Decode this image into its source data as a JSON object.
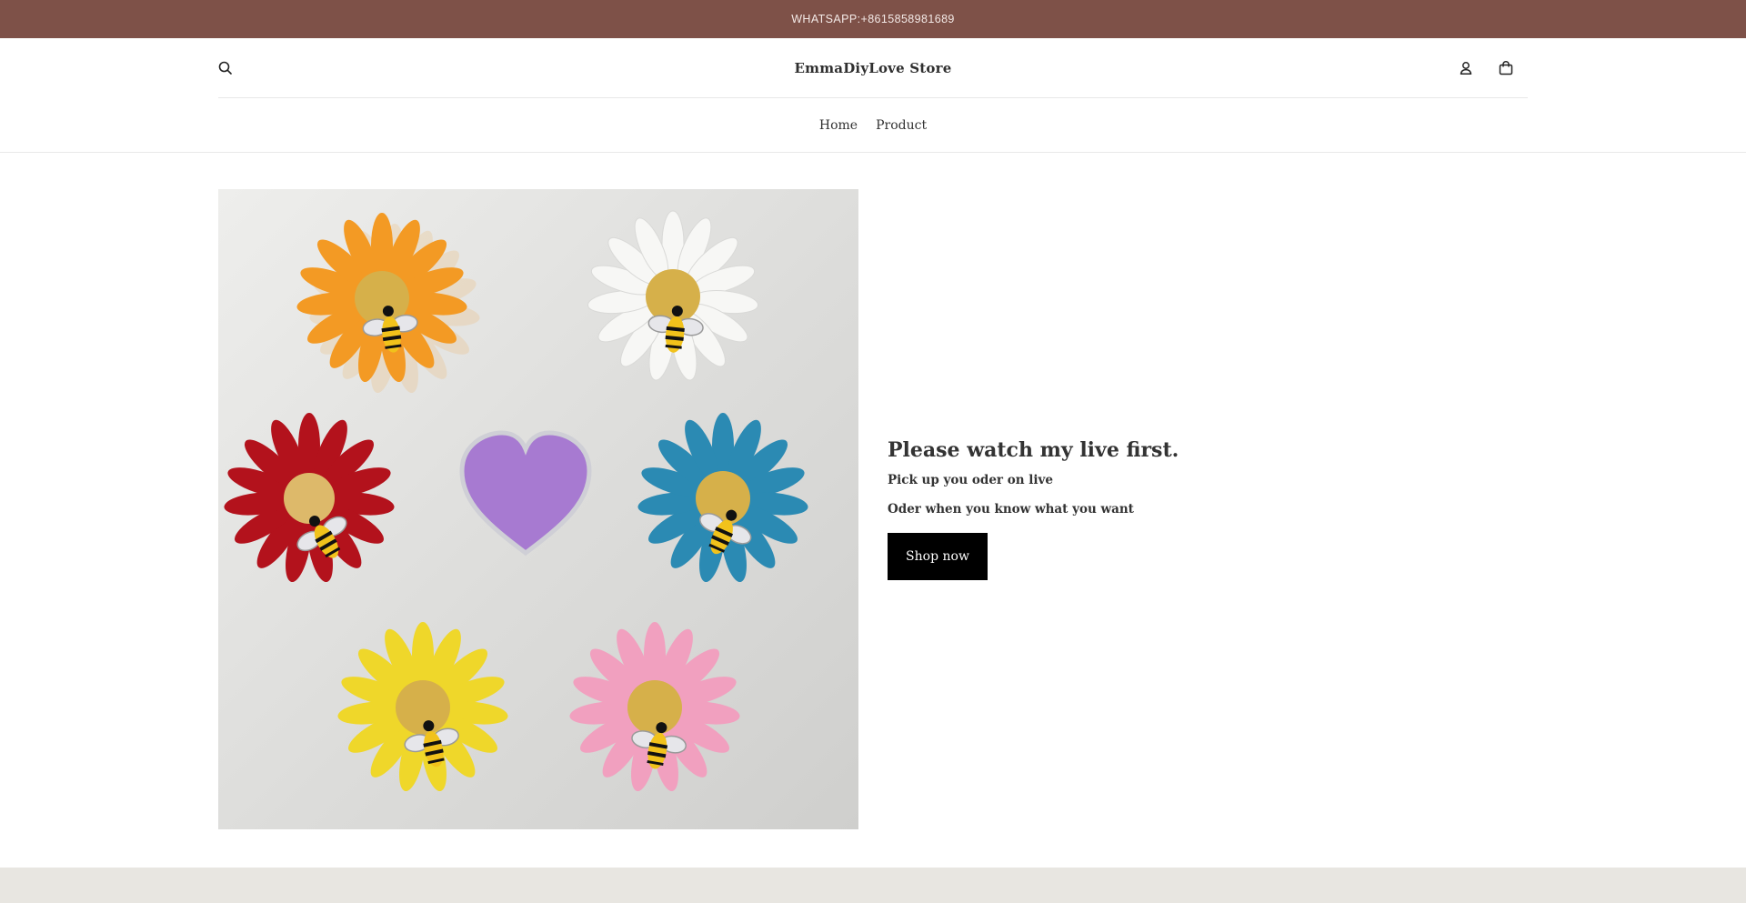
{
  "announcement": {
    "text": "WHATSAPP:+8615858981689"
  },
  "header": {
    "logo": "EmmaDiyLove Store",
    "icons": {
      "search": "search-icon",
      "account": "account-icon",
      "cart": "cart-icon"
    }
  },
  "nav": {
    "items": [
      {
        "label": "Home"
      },
      {
        "label": "Product"
      }
    ]
  },
  "hero": {
    "image_alt": "flower-bee-charms-photo",
    "heading": "Please watch my live first.",
    "line1": "Pick up you oder on live",
    "line2": "Oder when you know what you want",
    "button_label": "Shop now"
  },
  "colors": {
    "announcement_bg": "#7e5148",
    "button_bg": "#000000",
    "footer_bg": "#e8e6e1",
    "flowers": [
      "#f39a24",
      "#f4f4f2",
      "#b3121c",
      "#2b8ab3",
      "#efd72a",
      "#f1a0bf"
    ],
    "heart": "#a77ad1"
  }
}
